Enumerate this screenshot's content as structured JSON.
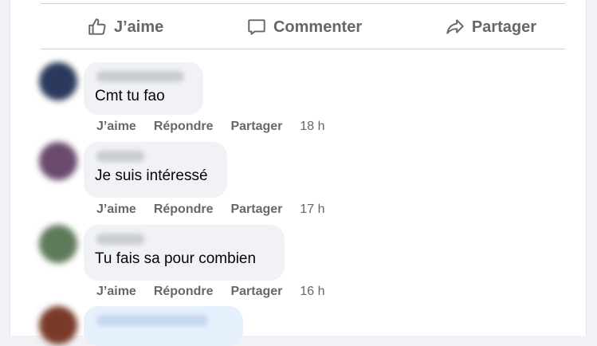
{
  "post_actions": {
    "like": "J’aime",
    "comment": "Commenter",
    "share": "Partager"
  },
  "comments": [
    {
      "text": "Cmt tu fao",
      "like": "J’aime",
      "reply": "Répondre",
      "share": "Partager",
      "time": "18 h",
      "avatar_color": "#2b3a5c"
    },
    {
      "text": "Je suis intéressé",
      "like": "J’aime",
      "reply": "Répondre",
      "share": "Partager",
      "time": "17 h",
      "avatar_color": "#6b4a6e"
    },
    {
      "text": "Tu fais sa pour combien",
      "like": "J’aime",
      "reply": "Répondre",
      "share": "Partager",
      "time": "16 h",
      "avatar_color": "#5f7a5a"
    },
    {
      "text": "",
      "avatar_color": "#7a3a2a"
    }
  ],
  "colors": {
    "secondary_text": "#65676b",
    "bubble_bg": "#f0f2f5",
    "page_bg": "#f0f2f5"
  }
}
